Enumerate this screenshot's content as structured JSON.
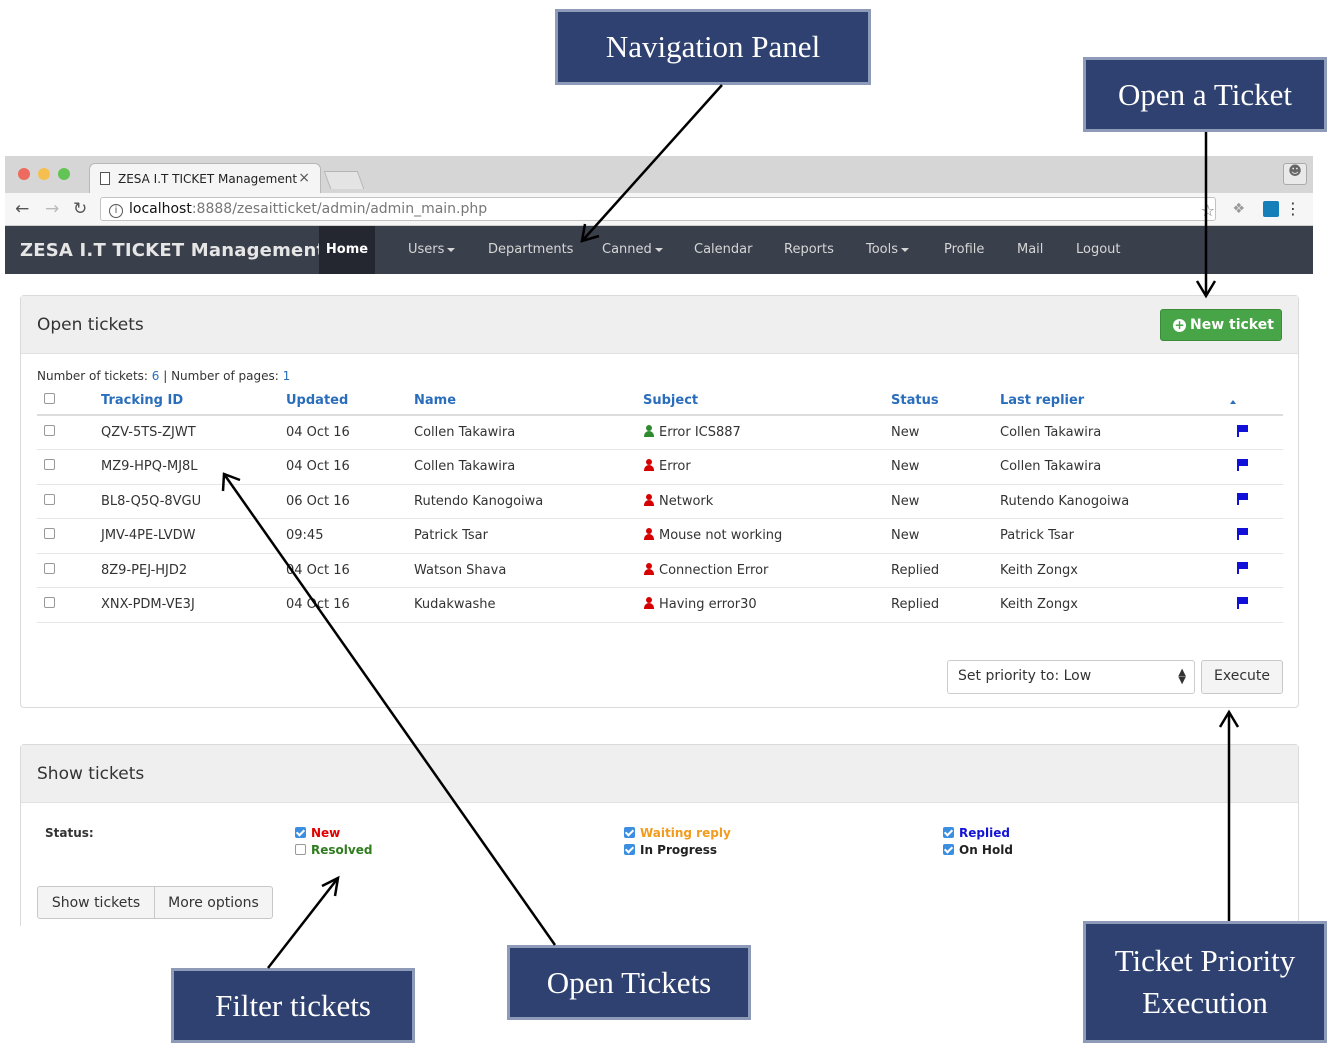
{
  "callouts": {
    "navigation_panel": "Navigation Panel",
    "open_a_ticket": "Open a Ticket",
    "filter_tickets": "Filter tickets",
    "open_tickets": "Open Tickets",
    "priority_line1": "Ticket Priority",
    "priority_line2": "Execution"
  },
  "browser": {
    "tab_title": "ZESA I.T TICKET Management",
    "tab_close": "×",
    "url_host": "localhost",
    "url_rest": ":8888/zesaitticket/admin/admin_main.php"
  },
  "navbar": {
    "brand": "ZESA I.T TICKET Management",
    "items": [
      "Home",
      "Users",
      "Departments",
      "Canned",
      "Calendar",
      "Reports",
      "Tools",
      "Profile",
      "Mail",
      "Logout"
    ]
  },
  "open_panel": {
    "title": "Open tickets",
    "new_ticket_label": "New ticket",
    "count_prefix": "Number of tickets: ",
    "ticket_count": "6",
    "pages_prefix": " | Number of pages: ",
    "page_count": "1",
    "columns": [
      "Tracking ID",
      "Updated",
      "Name",
      "Subject",
      "Status",
      "Last replier"
    ],
    "rows": [
      {
        "id": "QZV-5TS-ZJWT",
        "updated": "04 Oct 16",
        "name": "Collen Takawira",
        "subject": "Error ICS887",
        "status": "New",
        "last_replier": "Collen Takawira",
        "owner_icon": "green-person-icon"
      },
      {
        "id": "MZ9-HPQ-MJ8L",
        "updated": "04 Oct 16",
        "name": "Collen Takawira",
        "subject": "Error",
        "status": "New",
        "last_replier": "Collen Takawira",
        "owner_icon": "red-person-icon"
      },
      {
        "id": "BL8-Q5Q-8VGU",
        "updated": "06 Oct 16",
        "name": "Rutendo Kanogoiwa",
        "subject": "Network",
        "status": "New",
        "last_replier": "Rutendo Kanogoiwa",
        "owner_icon": "red-person-icon"
      },
      {
        "id": "JMV-4PE-LVDW",
        "updated": "09:45",
        "name": "Patrick Tsar",
        "subject": "Mouse not working",
        "status": "New",
        "last_replier": "Patrick Tsar",
        "owner_icon": "red-person-icon"
      },
      {
        "id": "8Z9-PEJ-HJD2",
        "updated": "04 Oct 16",
        "name": "Watson Shava",
        "subject": "Connection Error",
        "status": "Replied",
        "last_replier": "Keith Zongx",
        "owner_icon": "red-person-icon"
      },
      {
        "id": "XNX-PDM-VE3J",
        "updated": "04 Oct 16",
        "name": "Kudakwashe",
        "subject": "Having error30",
        "status": "Replied",
        "last_replier": "Keith Zongx",
        "owner_icon": "red-person-icon"
      }
    ],
    "priority_select_value": "Set priority to: Low",
    "execute_label": "Execute"
  },
  "show_panel": {
    "title": "Show tickets",
    "status_label": "Status:",
    "filters": [
      {
        "label": "New",
        "checked": true,
        "color": "#e20000"
      },
      {
        "label": "Resolved",
        "checked": false,
        "color": "#2f7d1f"
      },
      {
        "label": "Waiting reply",
        "checked": true,
        "color": "#f39b1c"
      },
      {
        "label": "In Progress",
        "checked": true,
        "color": "#222222"
      },
      {
        "label": "Replied",
        "checked": true,
        "color": "#1414d6"
      },
      {
        "label": "On Hold",
        "checked": true,
        "color": "#222222"
      }
    ],
    "show_button": "Show tickets",
    "more_button": "More options"
  }
}
